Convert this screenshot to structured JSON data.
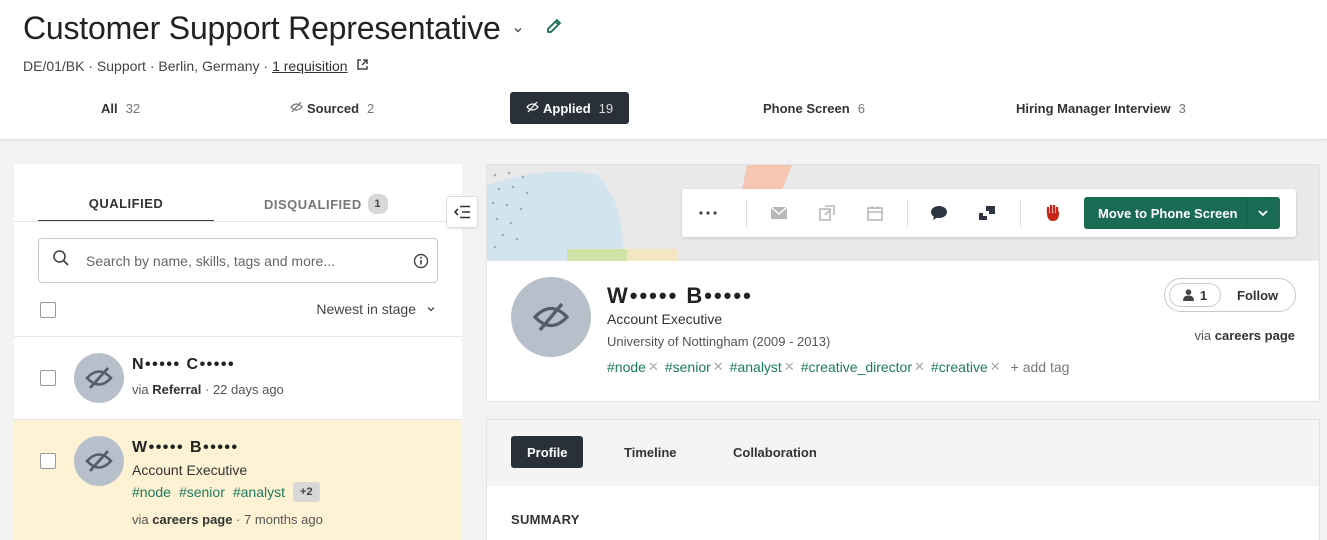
{
  "job": {
    "title": "Customer Support Representative",
    "meta": "DE/01/BK · Support · Berlin, Germany ·",
    "requisition_link": "1 requisition"
  },
  "stages": [
    {
      "label": "All",
      "count": "32",
      "icon": ""
    },
    {
      "label": "Sourced",
      "count": "2",
      "icon": "eye-slash-icon"
    },
    {
      "label": "Applied",
      "count": "19",
      "icon": "eye-slash-icon",
      "active": true
    },
    {
      "label": "Phone Screen",
      "count": "6",
      "icon": ""
    },
    {
      "label": "Hiring Manager Interview",
      "count": "3",
      "icon": ""
    }
  ],
  "list": {
    "tab_qualified": "QUALIFIED",
    "tab_disqualified": "DISQUALIFIED",
    "disqualified_count": "1",
    "search_placeholder": "Search by name, skills, tags and more...",
    "sort_label": "Newest in stage",
    "candidates": [
      {
        "name": "N••••• C•••••",
        "source_prefix": "via",
        "source": "Referral",
        "age": "· 22 days ago"
      },
      {
        "name": "W••••• B•••••",
        "title": "Account Executive",
        "tags": [
          "#node",
          "#senior",
          "#analyst"
        ],
        "more": "+2",
        "source_prefix": "via",
        "source": "careers page",
        "age": "· 7 months ago"
      }
    ]
  },
  "profile": {
    "name": "W••••• B•••••",
    "title": "Account Executive",
    "education": "University of Nottingham (2009 - 2013)",
    "tags": [
      "#node",
      "#senior",
      "#analyst",
      "#creative_director",
      "#creative"
    ],
    "add_tag": "add tag",
    "followers": "1",
    "follow_label": "Follow",
    "via_prefix": "via",
    "via_source": "careers page",
    "move_button": "Move to Phone Screen",
    "tabs": [
      "Profile",
      "Timeline",
      "Collaboration"
    ],
    "summary_heading": "SUMMARY"
  },
  "colors": {
    "primary": "#1a6b54",
    "tag": "#1e7a5f",
    "active_tab": "#2a3038",
    "highlight_row": "#fdf2d3"
  }
}
